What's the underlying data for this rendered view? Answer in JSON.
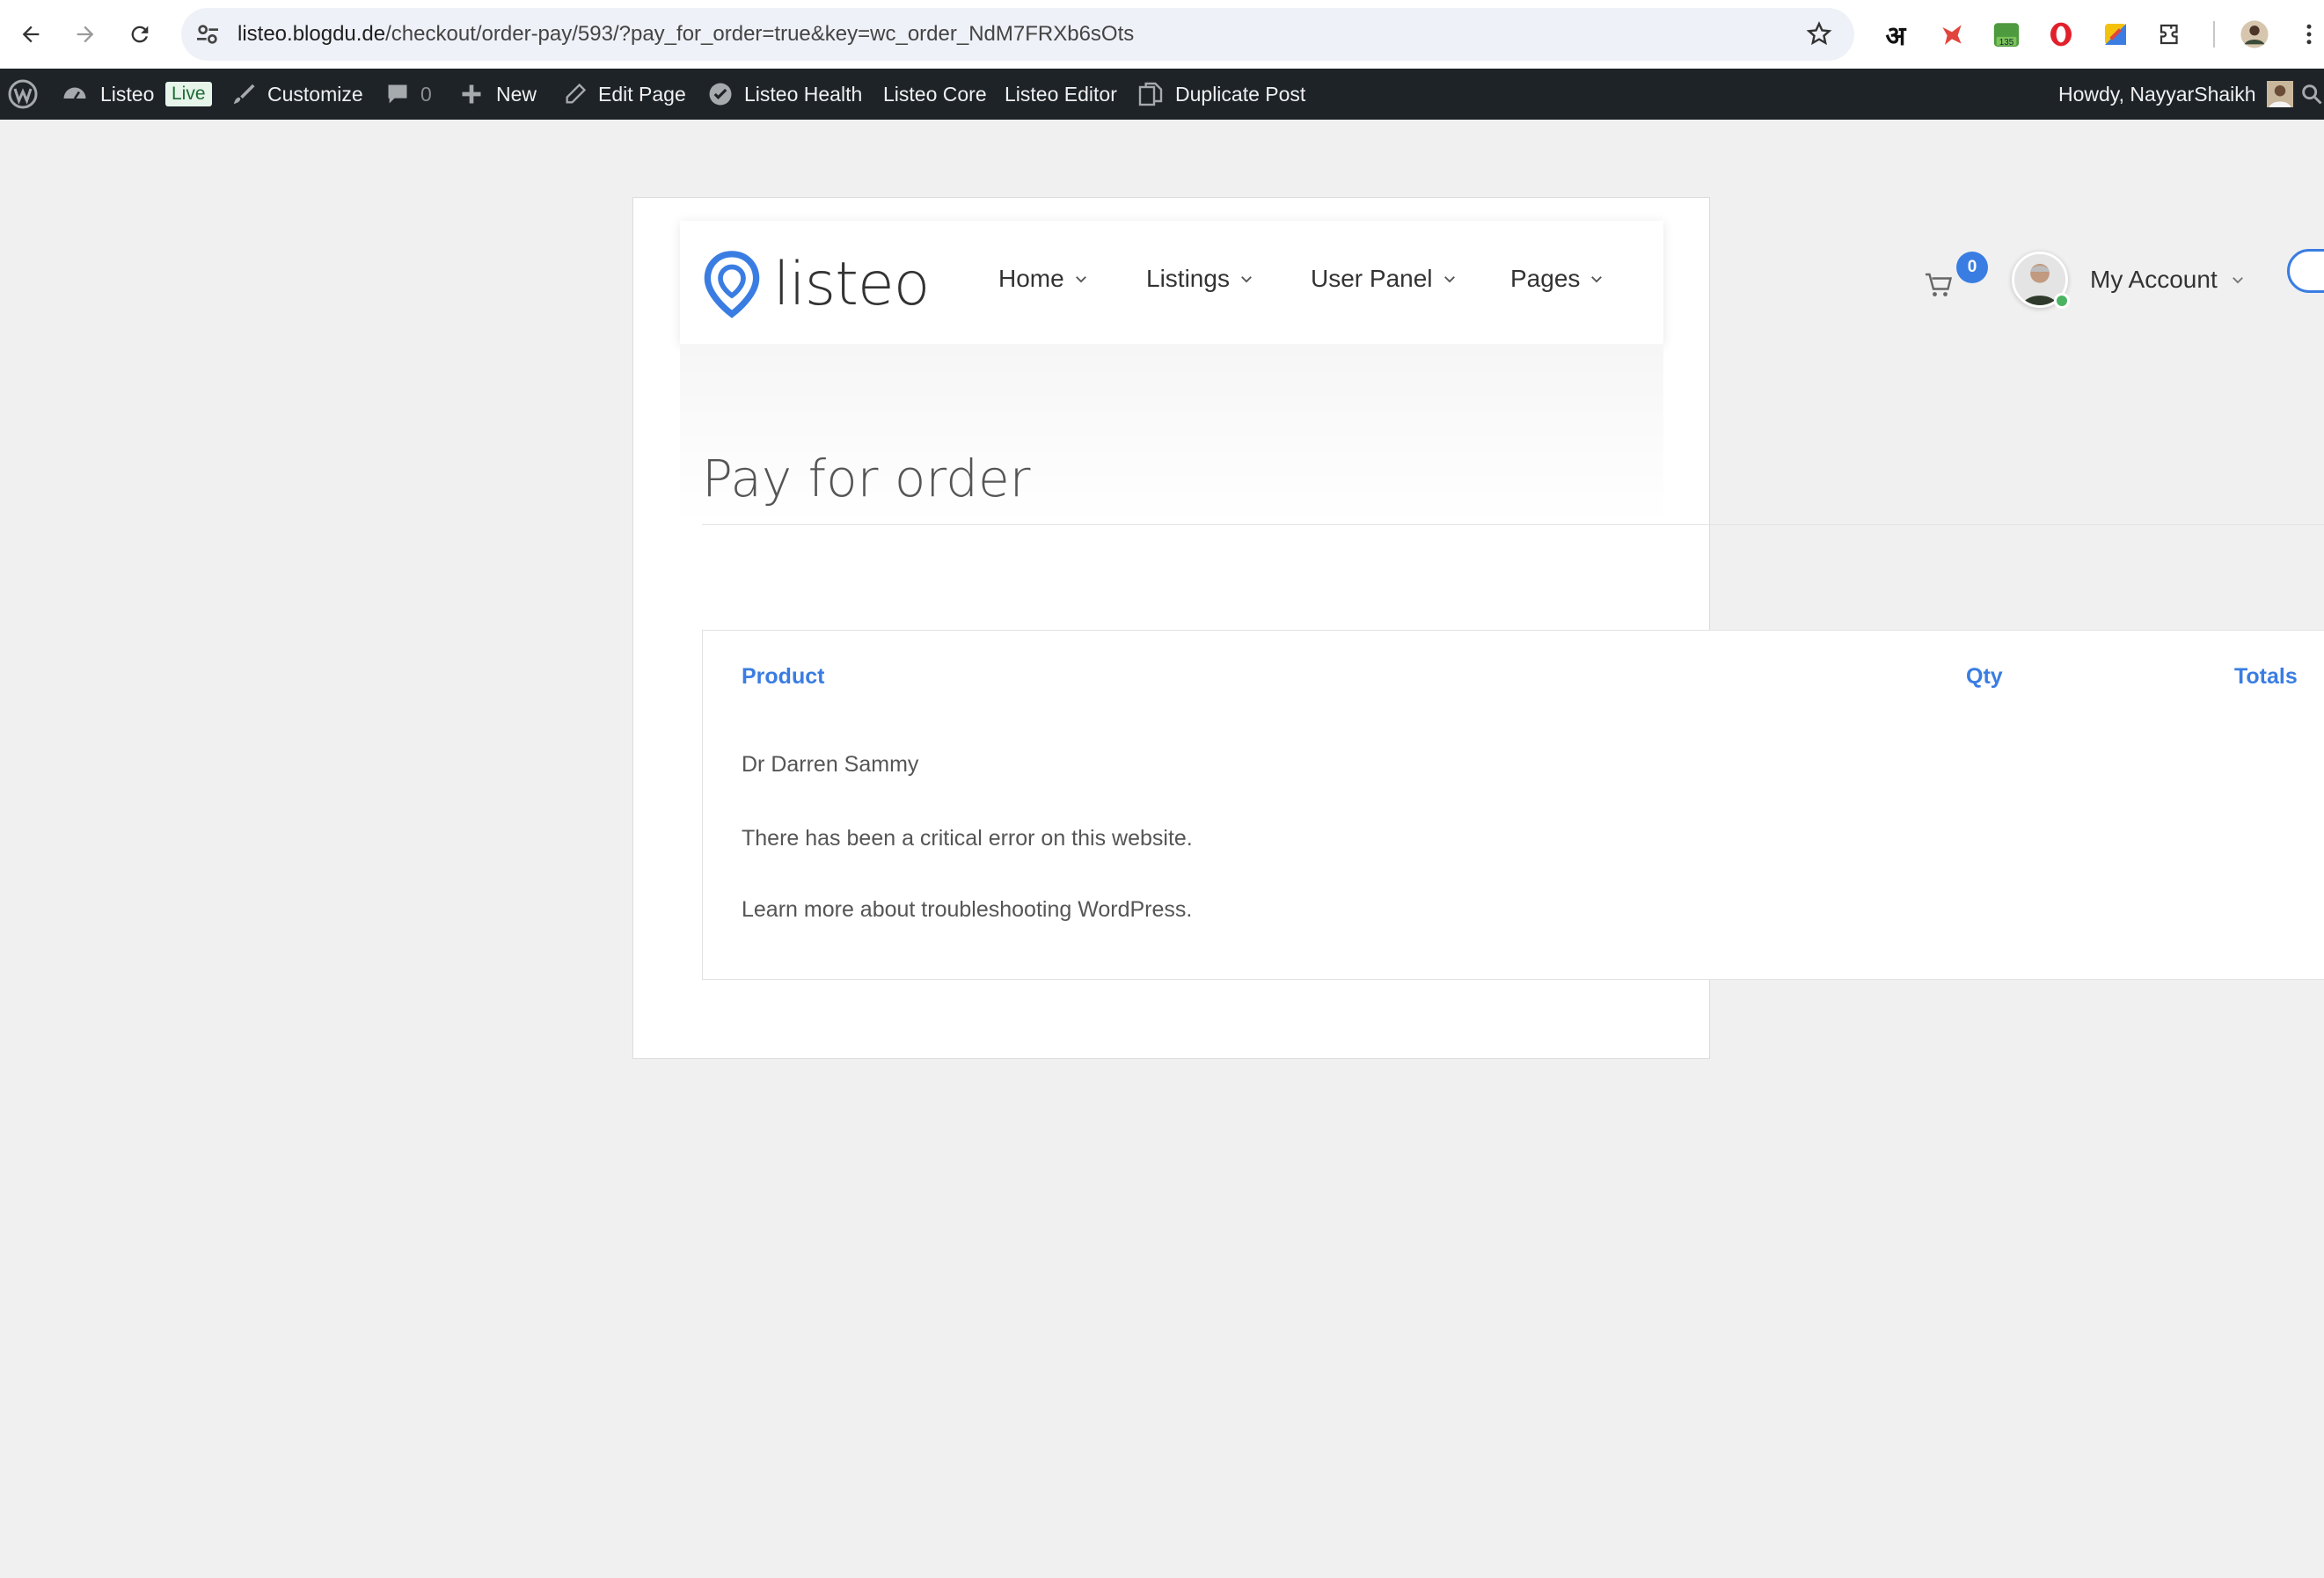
{
  "browser": {
    "url_host": "listeo.blogdu.de",
    "url_path": "/checkout/order-pay/593/?pay_for_order=true&key=wc_order_NdM7FRXb6sOts",
    "extensions": {
      "hindi_glyph": "अ",
      "badge_count": "135"
    }
  },
  "admin_bar": {
    "site_name": "Listeo",
    "live_badge": "Live",
    "customize": "Customize",
    "comments_count": "0",
    "new": "New",
    "edit_page": "Edit Page",
    "listeo_health": "Listeo Health",
    "listeo_core": "Listeo Core",
    "listeo_editor": "Listeo Editor",
    "duplicate_post": "Duplicate Post",
    "greeting": "Howdy, NayyarShaikh"
  },
  "site": {
    "logo_text": "listeo",
    "menu": [
      "Home",
      "Listings",
      "User Panel",
      "Pages"
    ],
    "cart_count": "0",
    "account_label": "My Account",
    "accent_color": "#3a7de2"
  },
  "page": {
    "title": "Pay for order",
    "table_headers": {
      "product": "Product",
      "qty": "Qty",
      "totals": "Totals"
    },
    "rows": [
      "Dr Darren Sammy",
      "There has been a critical error on this website.",
      "Learn more about troubleshooting WordPress."
    ]
  }
}
